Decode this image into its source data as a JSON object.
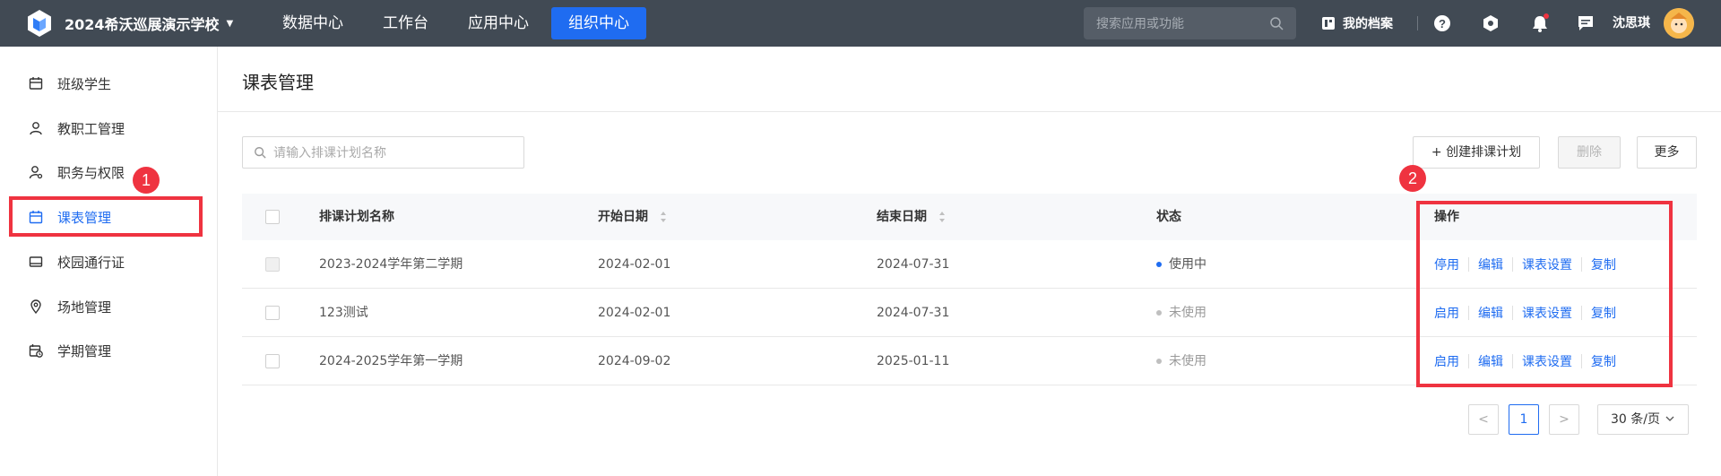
{
  "topbar": {
    "school_name": "2024希沃巡展演示学校",
    "nav": [
      "数据中心",
      "工作台",
      "应用中心",
      "组织中心"
    ],
    "active_nav": "组织中心",
    "search_placeholder": "搜索应用或功能",
    "archive_label": "我的档案",
    "user_name": "沈思琪"
  },
  "sidebar": {
    "items": [
      {
        "label": "班级学生",
        "icon": "class-icon"
      },
      {
        "label": "教职工管理",
        "icon": "person-icon"
      },
      {
        "label": "职务与权限",
        "icon": "person-key-icon"
      },
      {
        "label": "课表管理",
        "icon": "calendar-icon"
      },
      {
        "label": "校园通行证",
        "icon": "card-icon"
      },
      {
        "label": "场地管理",
        "icon": "location-icon"
      },
      {
        "label": "学期管理",
        "icon": "calendar-clock-icon"
      }
    ],
    "active_index": 3
  },
  "annotations": {
    "badge1": "1",
    "badge2": "2"
  },
  "main": {
    "title": "课表管理",
    "search_placeholder": "请输入排课计划名称",
    "create_button": "+ 创建排课计划",
    "delete_button": "删除",
    "more_button": "更多",
    "columns": {
      "name": "排课计划名称",
      "start": "开始日期",
      "end": "结束日期",
      "status": "状态",
      "ops": "操作"
    },
    "rows": [
      {
        "name": "2023-2024学年第二学期",
        "start": "2024-02-01",
        "end": "2024-07-31",
        "status": "使用中",
        "toggle": "停用",
        "edit": "编辑",
        "settings": "课表设置",
        "copy": "复制"
      },
      {
        "name": "123测试",
        "start": "2024-02-01",
        "end": "2024-07-31",
        "status": "未使用",
        "toggle": "启用",
        "edit": "编辑",
        "settings": "课表设置",
        "copy": "复制"
      },
      {
        "name": "2024-2025学年第一学期",
        "start": "2024-09-02",
        "end": "2025-01-11",
        "status": "未使用",
        "toggle": "启用",
        "edit": "编辑",
        "settings": "课表设置",
        "copy": "复制"
      }
    ],
    "pagination": {
      "prev": "<",
      "current_page": "1",
      "next": ">",
      "page_size": "30 条/页"
    }
  },
  "colors": {
    "primary": "#1f6cf1",
    "topbar": "#414a54",
    "annotation": "#ef3340",
    "status_on": "#1f6cf1",
    "status_off": "#bfbfbf"
  }
}
